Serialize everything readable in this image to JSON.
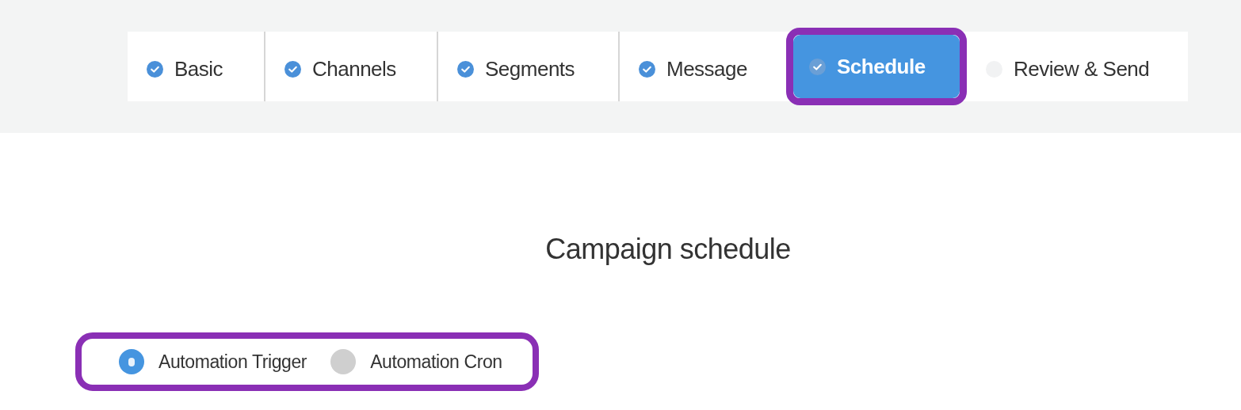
{
  "steps": [
    {
      "label": "Basic",
      "completed": true,
      "selected": false,
      "highlighted": false
    },
    {
      "label": "Channels",
      "completed": true,
      "selected": false,
      "highlighted": false
    },
    {
      "label": "Segments",
      "completed": true,
      "selected": false,
      "highlighted": false
    },
    {
      "label": "Message",
      "completed": true,
      "selected": false,
      "highlighted": false
    },
    {
      "label": "Schedule",
      "completed": true,
      "selected": true,
      "highlighted": true
    },
    {
      "label": "Review & Send",
      "completed": false,
      "selected": false,
      "highlighted": false
    }
  ],
  "title": "Campaign schedule",
  "schedule_type": {
    "highlighted": true,
    "options": [
      {
        "label": "Automation Trigger",
        "selected": true
      },
      {
        "label": "Automation Cron",
        "selected": false
      }
    ]
  }
}
